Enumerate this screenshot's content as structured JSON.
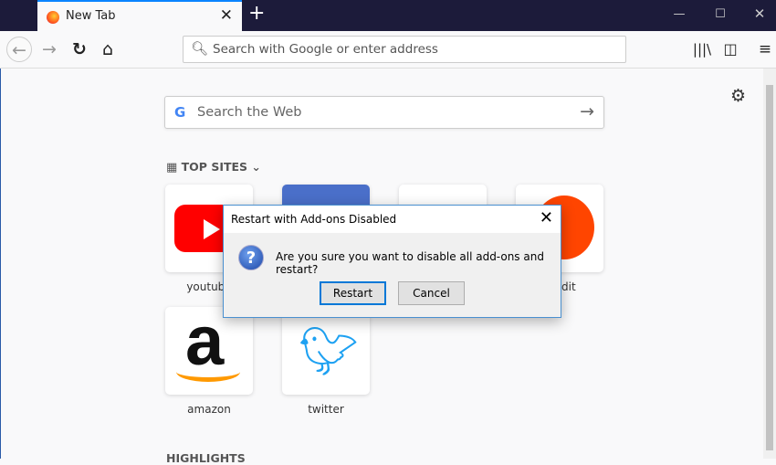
{
  "tab": {
    "title": "New Tab"
  },
  "urlbar": {
    "placeholder": "Search with Google or enter address"
  },
  "search": {
    "placeholder": "Search the Web"
  },
  "sections": {
    "top_sites": "TOP SITES",
    "highlights": "HIGHLIGHTS"
  },
  "top_sites": [
    {
      "label": "youtube"
    },
    {
      "label": "reddit"
    },
    {
      "label": "amazon"
    },
    {
      "label": "twitter"
    }
  ],
  "dialog": {
    "title": "Restart with Add-ons Disabled",
    "message": "Are you sure you want to disable all add-ons and restart?",
    "restart": "Restart",
    "cancel": "Cancel"
  },
  "colors": {
    "accent": "#0a84ff",
    "titlebar": "#1c1b3a"
  }
}
